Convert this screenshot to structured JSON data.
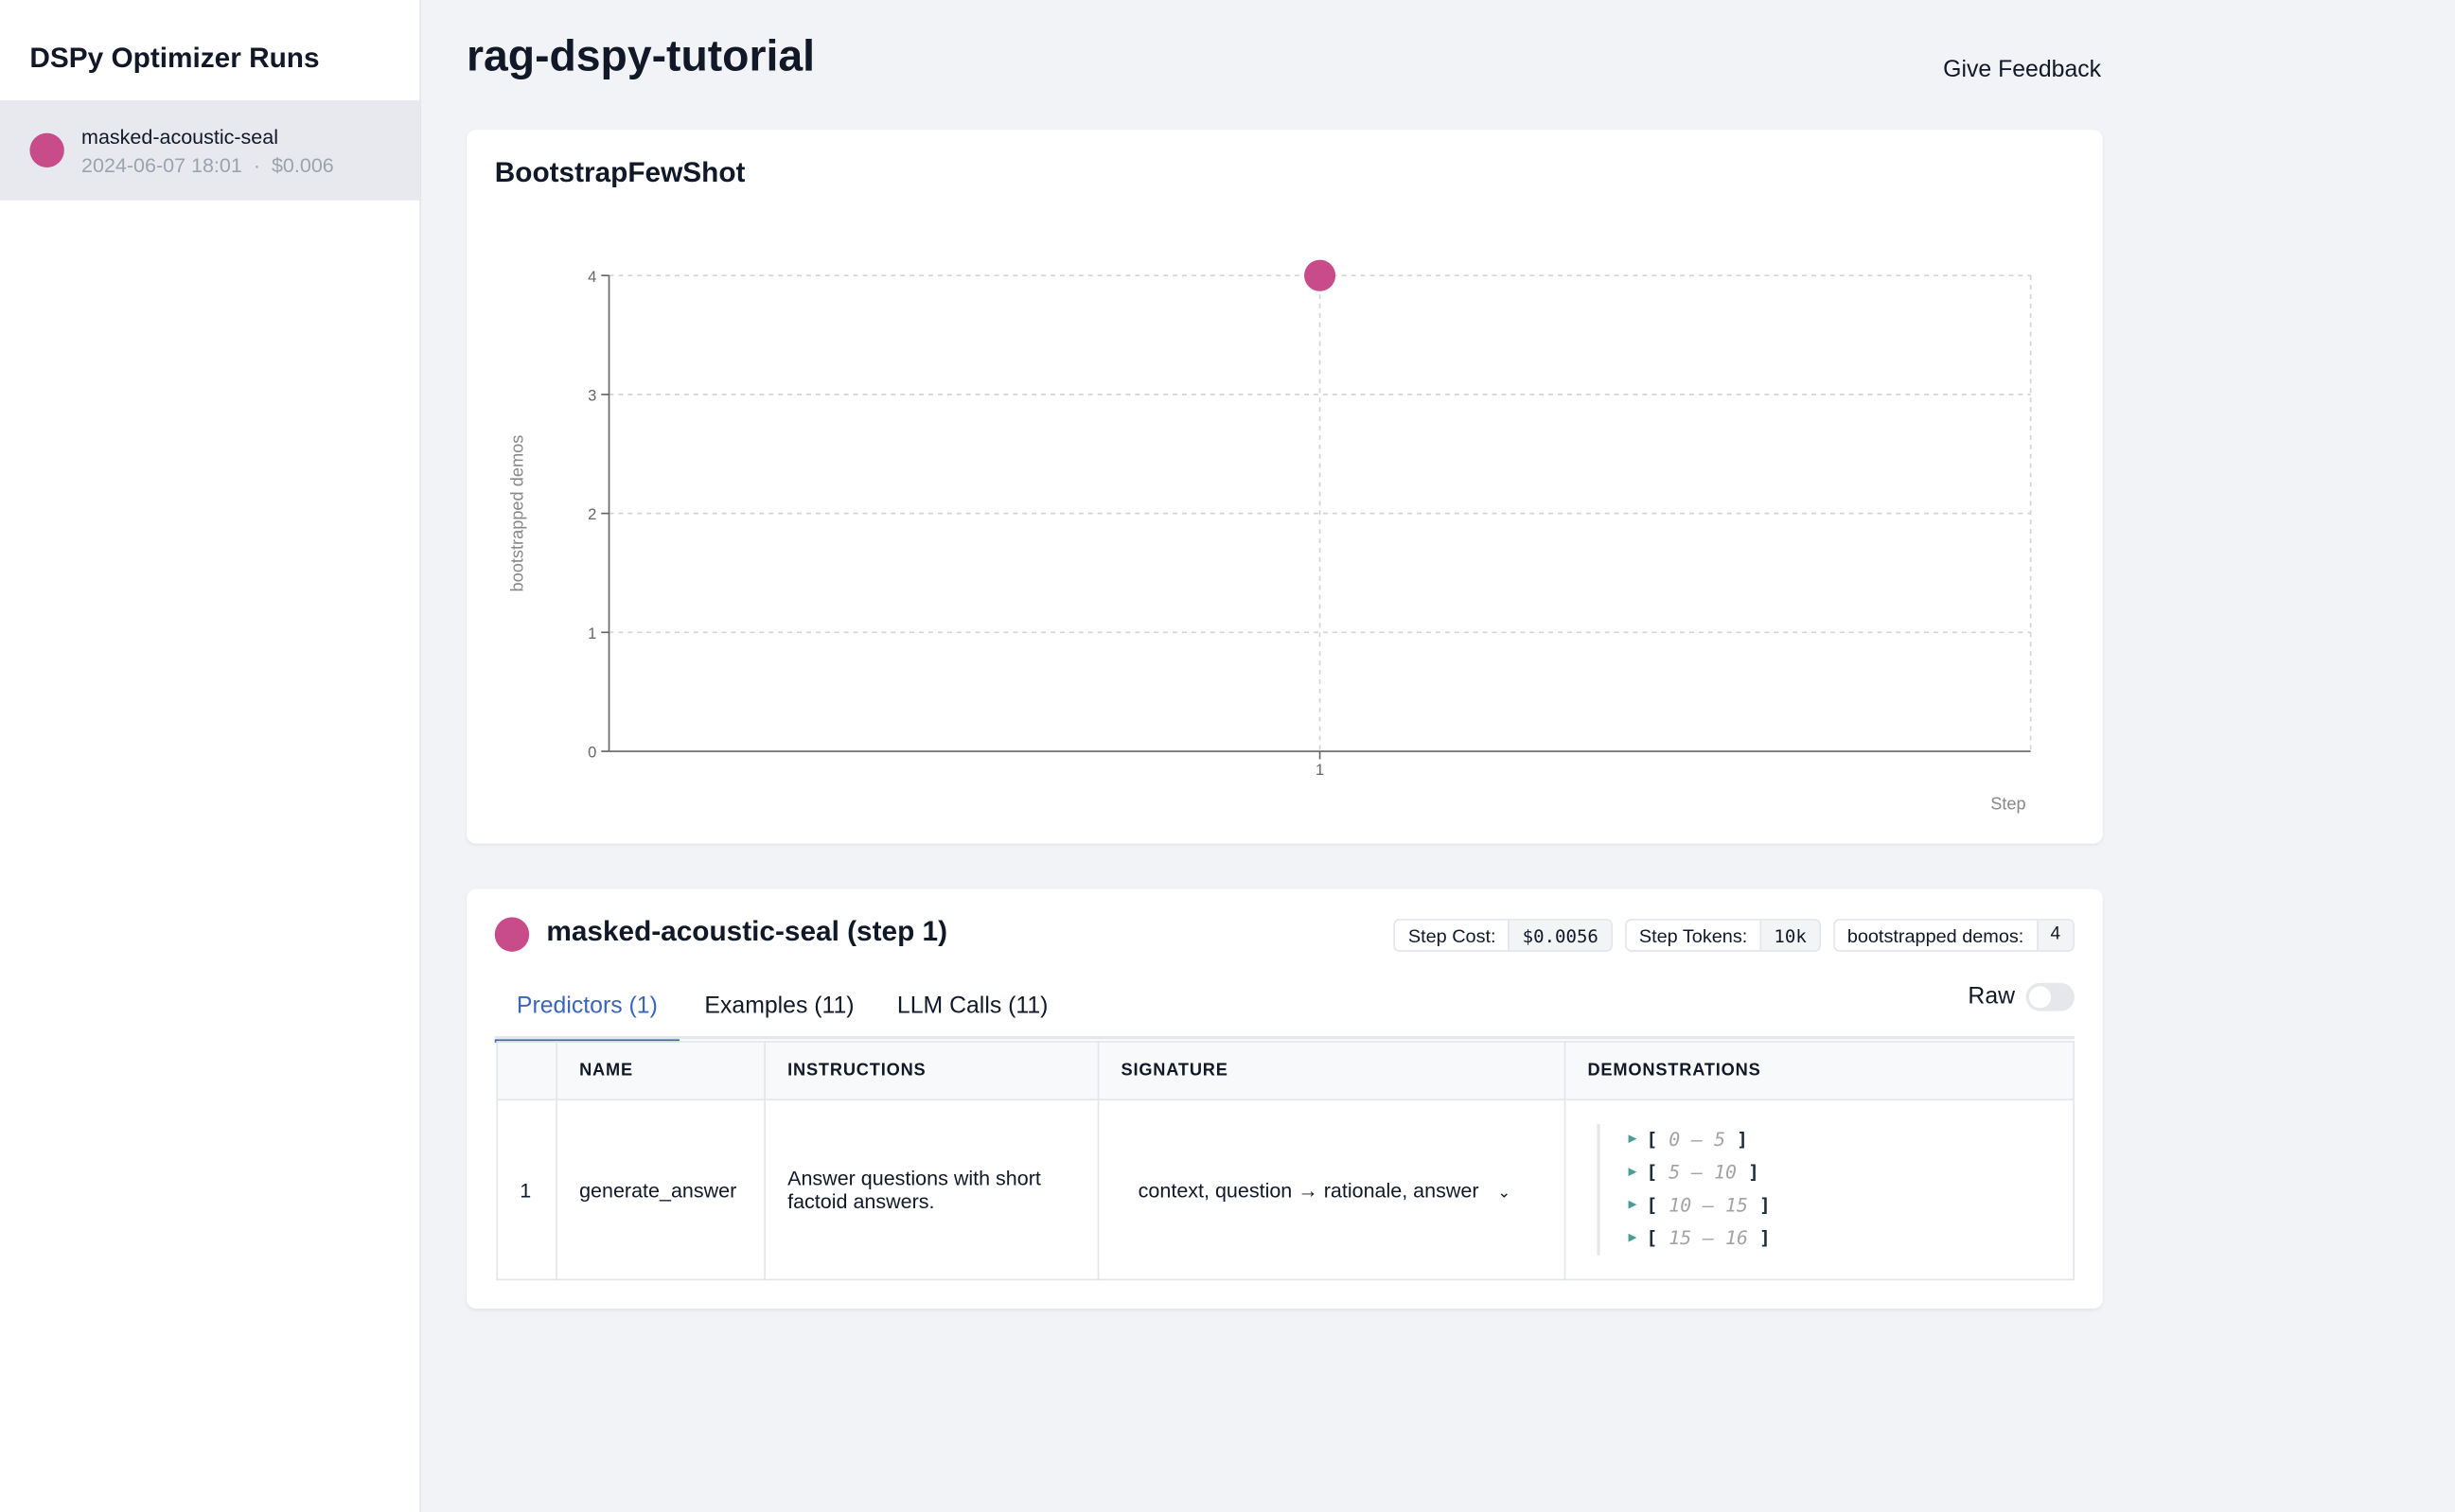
{
  "sidebar": {
    "title": "DSPy Optimizer Runs",
    "runs": [
      {
        "name": "masked-acoustic-seal",
        "date": "2024-06-07 18:01",
        "sep": "·",
        "cost": "$0.006",
        "color": "#c84b8a"
      }
    ]
  },
  "header": {
    "title": "rag-dspy-tutorial",
    "feedback": "Give Feedback"
  },
  "chart_card": {
    "title": "BootstrapFewShot"
  },
  "chart_data": {
    "type": "scatter",
    "x": [
      1
    ],
    "y": [
      4
    ],
    "xlabel": "Step",
    "ylabel": "bootstrapped demos",
    "xticks": [
      "1"
    ],
    "yticks": [
      "0",
      "1",
      "2",
      "3",
      "4"
    ],
    "ylim": [
      0,
      4
    ],
    "xlim": [
      0,
      2
    ],
    "grid": true,
    "color": "#c84b8a"
  },
  "step": {
    "title": "masked-acoustic-seal (step 1)",
    "badges": [
      {
        "label": "Step Cost:",
        "value": "$0.0056"
      },
      {
        "label": "Step Tokens:",
        "value": "10k"
      },
      {
        "label": "bootstrapped demos:",
        "value": "4"
      }
    ],
    "tabs": [
      {
        "label": "Predictors (1)",
        "active": true
      },
      {
        "label": "Examples (11)"
      },
      {
        "label": "LLM Calls (11)"
      }
    ],
    "raw_label": "Raw",
    "raw_on": false,
    "table": {
      "headers": [
        "",
        "NAME",
        "INSTRUCTIONS",
        "SIGNATURE",
        "DEMONSTRATIONS"
      ],
      "rows": [
        {
          "index": "1",
          "name": "generate_answer",
          "instructions": "Answer questions with short factoid answers.",
          "signature": "context, question → rationale, answer",
          "demos": [
            "0 – 5",
            "5 – 10",
            "10 – 15",
            "15 – 16"
          ]
        }
      ]
    }
  }
}
